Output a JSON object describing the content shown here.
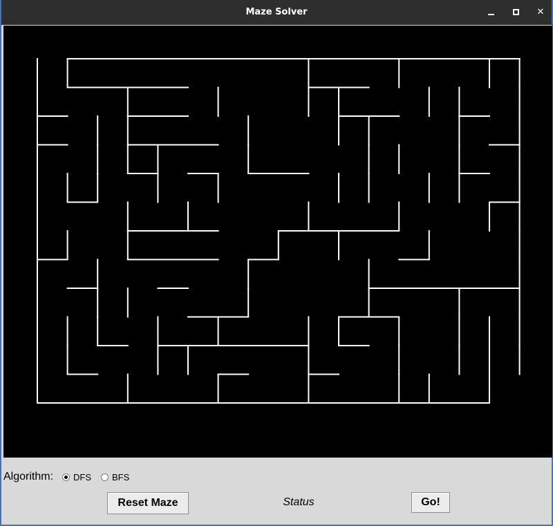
{
  "window": {
    "title": "Maze Solver",
    "accent_color": "#4a6fb5",
    "titlebar_color": "#2e2e2e"
  },
  "maze": {
    "cols": 16,
    "rows": 12,
    "background_color": "#000000",
    "wall_color": "#ffffff",
    "entrance": "top-left",
    "exit": "bottom-right",
    "horizontal_walls": [
      [
        0,
        1,
        1,
        1,
        1,
        1,
        1,
        1,
        1,
        1,
        1,
        1,
        1,
        1,
        1,
        1
      ],
      [
        0,
        1,
        1,
        1,
        1,
        0,
        0,
        0,
        0,
        1,
        1,
        0,
        0,
        0,
        0,
        0
      ],
      [
        1,
        0,
        0,
        1,
        1,
        0,
        0,
        0,
        0,
        0,
        1,
        1,
        0,
        0,
        1,
        0
      ],
      [
        1,
        0,
        0,
        1,
        1,
        1,
        0,
        0,
        0,
        0,
        0,
        0,
        0,
        0,
        0,
        1
      ],
      [
        0,
        0,
        0,
        1,
        0,
        1,
        0,
        1,
        1,
        0,
        0,
        0,
        0,
        0,
        1,
        0
      ],
      [
        0,
        1,
        0,
        0,
        0,
        0,
        0,
        0,
        0,
        0,
        0,
        0,
        0,
        0,
        0,
        1
      ],
      [
        0,
        0,
        0,
        1,
        1,
        1,
        0,
        0,
        1,
        1,
        1,
        1,
        0,
        0,
        0,
        0
      ],
      [
        1,
        0,
        0,
        1,
        1,
        1,
        0,
        1,
        0,
        0,
        0,
        0,
        1,
        0,
        0,
        0
      ],
      [
        0,
        1,
        0,
        0,
        1,
        0,
        0,
        0,
        0,
        0,
        0,
        1,
        1,
        1,
        1,
        1
      ],
      [
        0,
        0,
        0,
        0,
        0,
        1,
        1,
        0,
        0,
        0,
        1,
        1,
        0,
        0,
        0,
        0
      ],
      [
        0,
        0,
        1,
        0,
        1,
        1,
        1,
        1,
        1,
        0,
        1,
        0,
        0,
        0,
        0,
        0
      ],
      [
        0,
        1,
        0,
        0,
        0,
        0,
        1,
        0,
        0,
        1,
        0,
        0,
        0,
        0,
        0,
        0
      ],
      [
        1,
        1,
        1,
        1,
        1,
        1,
        1,
        1,
        1,
        1,
        1,
        1,
        1,
        1,
        1,
        0
      ]
    ],
    "vertical_walls": [
      [
        1,
        1,
        0,
        0,
        0,
        0,
        0,
        0,
        0,
        1,
        0,
        0,
        1,
        0,
        0,
        1,
        1
      ],
      [
        1,
        0,
        0,
        1,
        0,
        0,
        1,
        0,
        0,
        1,
        1,
        0,
        0,
        1,
        1,
        0,
        1
      ],
      [
        1,
        0,
        1,
        1,
        0,
        0,
        0,
        1,
        0,
        0,
        1,
        1,
        0,
        0,
        1,
        0,
        1
      ],
      [
        1,
        0,
        1,
        1,
        1,
        0,
        0,
        1,
        0,
        0,
        0,
        1,
        1,
        0,
        1,
        0,
        1
      ],
      [
        1,
        1,
        1,
        0,
        1,
        0,
        1,
        0,
        0,
        0,
        1,
        1,
        0,
        1,
        1,
        0,
        1
      ],
      [
        1,
        0,
        0,
        1,
        0,
        1,
        0,
        0,
        0,
        1,
        0,
        0,
        1,
        0,
        0,
        1,
        1
      ],
      [
        1,
        1,
        0,
        1,
        0,
        0,
        0,
        0,
        1,
        0,
        1,
        0,
        0,
        1,
        0,
        0,
        1
      ],
      [
        1,
        0,
        1,
        0,
        0,
        0,
        0,
        1,
        0,
        0,
        0,
        1,
        0,
        0,
        0,
        0,
        1
      ],
      [
        1,
        0,
        1,
        1,
        0,
        0,
        0,
        1,
        0,
        0,
        0,
        1,
        0,
        0,
        1,
        0,
        1
      ],
      [
        1,
        1,
        1,
        0,
        1,
        0,
        1,
        0,
        0,
        1,
        1,
        0,
        1,
        0,
        1,
        1,
        1
      ],
      [
        1,
        1,
        0,
        0,
        1,
        1,
        0,
        0,
        0,
        1,
        0,
        0,
        1,
        0,
        1,
        1,
        1
      ],
      [
        1,
        0,
        0,
        1,
        0,
        0,
        1,
        0,
        0,
        1,
        0,
        0,
        1,
        1,
        0,
        1,
        0
      ]
    ]
  },
  "controls": {
    "algorithm_label": "Algorithm:",
    "options": [
      {
        "label": "DFS",
        "selected": true
      },
      {
        "label": "BFS",
        "selected": false
      }
    ],
    "reset_label": "Reset Maze",
    "status_text": "Status",
    "go_label": "Go!"
  }
}
